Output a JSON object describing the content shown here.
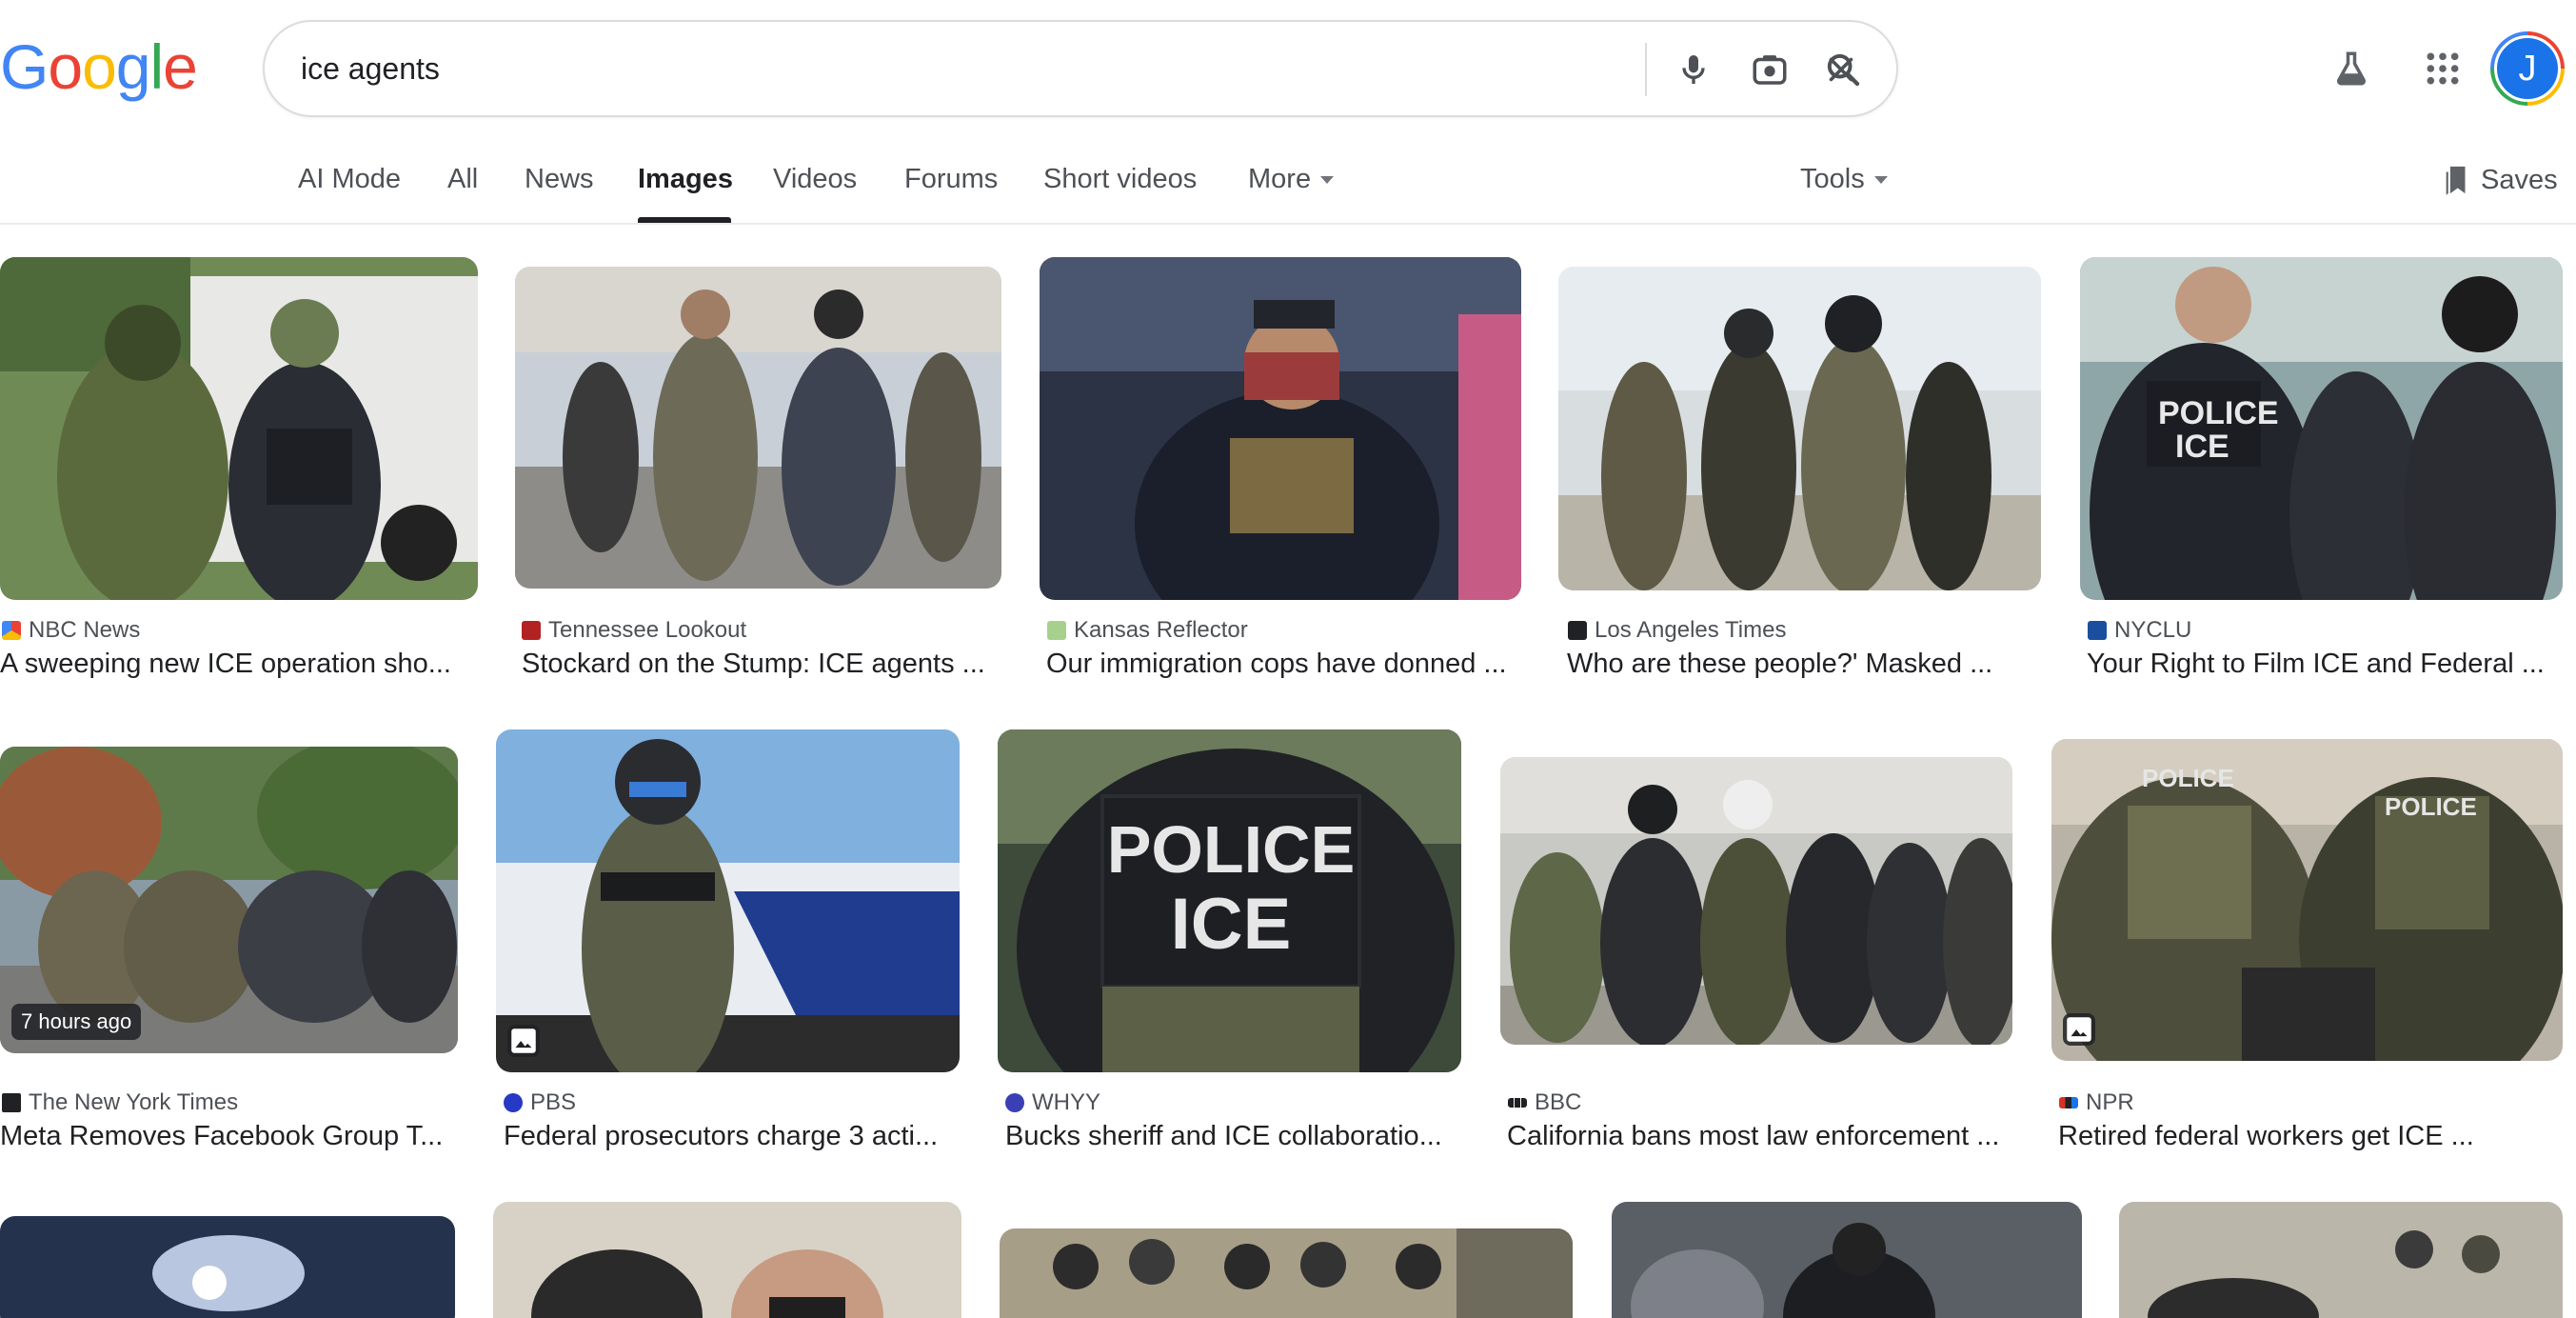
{
  "search": {
    "query": "ice agents"
  },
  "logo": {
    "text": "Google"
  },
  "tabs": [
    {
      "label": "AI Mode"
    },
    {
      "label": "All"
    },
    {
      "label": "News"
    },
    {
      "label": "Images"
    },
    {
      "label": "Videos"
    },
    {
      "label": "Forums"
    },
    {
      "label": "Short videos"
    },
    {
      "label": "More"
    }
  ],
  "tools": {
    "label": "Tools"
  },
  "saves": {
    "label": "Saves"
  },
  "account": {
    "initial": "J"
  },
  "results": [
    {
      "source": "NBC News",
      "title": "A sweeping new ICE operation sho...",
      "favicon_color": "#6e3ca7",
      "badge": ""
    },
    {
      "source": "Tennessee Lookout",
      "title": "Stockard on the Stump: ICE agents ...",
      "favicon_color": "#b22222",
      "badge": ""
    },
    {
      "source": "Kansas Reflector",
      "title": "Our immigration cops have donned ...",
      "favicon_color": "#6aa84f",
      "badge": ""
    },
    {
      "source": "Los Angeles Times",
      "title": "Who are these people?' Masked ...",
      "favicon_color": "#202124",
      "badge": ""
    },
    {
      "source": "NYCLU",
      "title": "Your Right to Film ICE and Federal ...",
      "favicon_color": "#1a4fa0",
      "badge": ""
    },
    {
      "source": "The New York Times",
      "title": "Meta Removes Facebook Group T...",
      "favicon_color": "#202124",
      "badge": "7 hours ago"
    },
    {
      "source": "PBS",
      "title": "Federal prosecutors charge 3 acti...",
      "favicon_color": "#2638c4",
      "badge": ""
    },
    {
      "source": "WHYY",
      "title": "Bucks sheriff and ICE collaboratio...",
      "favicon_color": "#3b3fb6",
      "badge": ""
    },
    {
      "source": "BBC",
      "title": "California bans most law enforcement ...",
      "favicon_color": "#202124",
      "badge": ""
    },
    {
      "source": "NPR",
      "title": "Retired federal workers get ICE ...",
      "favicon_color": "#d93025",
      "badge": ""
    }
  ]
}
